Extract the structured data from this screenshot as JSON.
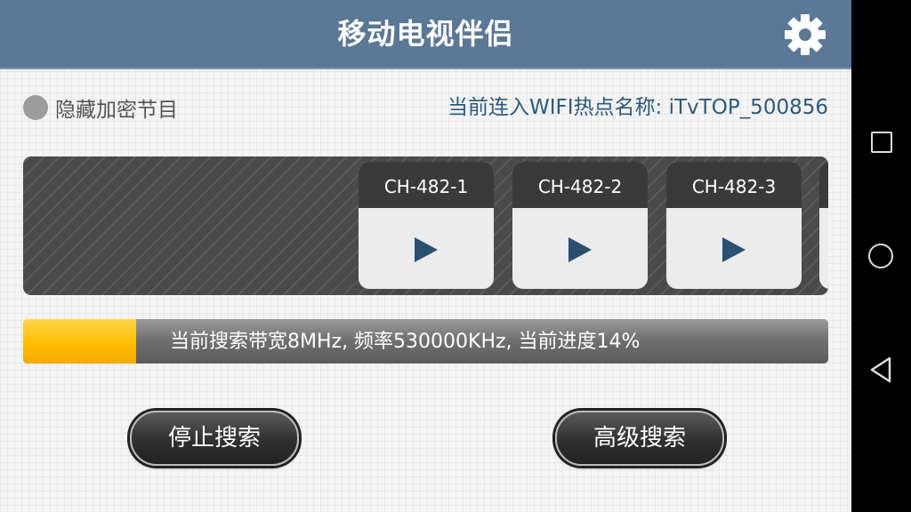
{
  "header": {
    "title": "移动电视伴侣",
    "settings_icon": "gear-icon"
  },
  "options": {
    "hide_encrypted_label": "隐藏加密节目",
    "hide_encrypted_checked": false
  },
  "wifi": {
    "text": "当前连入WIFI热点名称: iTvTOP_500856"
  },
  "channels": [
    {
      "name": "CH-482-1",
      "icon": "play-icon"
    },
    {
      "name": "CH-482-2",
      "icon": "play-icon"
    },
    {
      "name": "CH-482-3",
      "icon": "play-icon"
    }
  ],
  "scan": {
    "status_text": "当前搜索带宽8MHz, 频率530000KHz, 当前进度14%",
    "progress_percent": 14
  },
  "buttons": {
    "stop_label": "停止搜索",
    "advanced_label": "高级搜索"
  },
  "nav": {
    "recents_icon": "square-icon",
    "home_icon": "circle-icon",
    "back_icon": "triangle-back-icon"
  },
  "colors": {
    "header": "#5b7896",
    "accent": "#ffbd00",
    "wifi_text": "#2e5a7a",
    "play": "#2b4f70"
  }
}
